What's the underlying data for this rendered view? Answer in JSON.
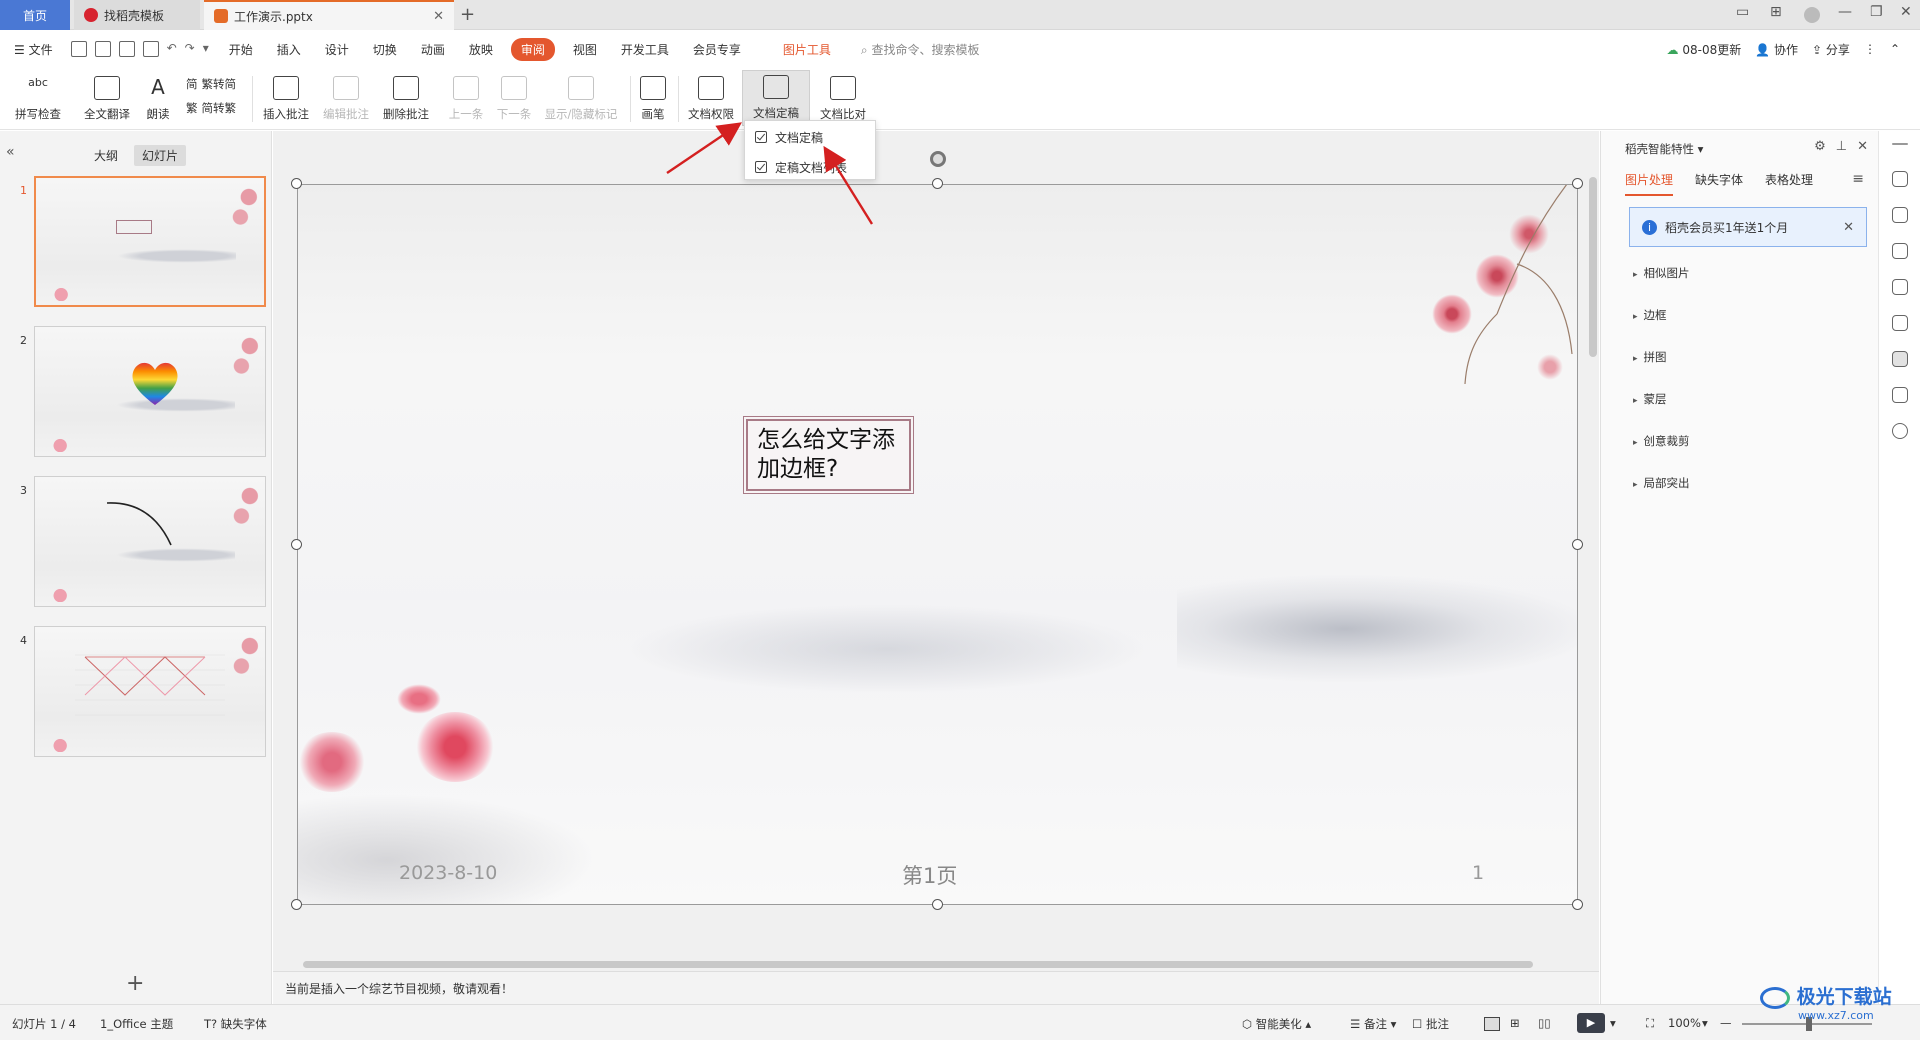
{
  "tabs": {
    "home": "首页",
    "template": "找稻壳模板",
    "doc": "工作演示.pptx"
  },
  "menu": {
    "file": "文件",
    "items": [
      "开始",
      "插入",
      "设计",
      "切换",
      "动画",
      "放映",
      "审阅",
      "视图",
      "开发工具",
      "会员专享"
    ],
    "active": "审阅",
    "picture_tool": "图片工具",
    "search_placeholder": "查找命令、搜索模板",
    "update": "08-08更新",
    "collab": "协作",
    "share": "分享"
  },
  "ribbon": {
    "spell_check": "拼写检查",
    "translate": "全文翻译",
    "read": "朗读",
    "trad_to_simp": "繁转简",
    "simp_to_trad": "简转繁",
    "insert_comment": "插入批注",
    "edit_comment": "编辑批注",
    "delete_comment": "删除批注",
    "prev": "上一条",
    "next": "下一条",
    "show_hide": "显示/隐藏标记",
    "pen": "画笔",
    "permission": "文档权限",
    "finalize": "文档定稿",
    "compare": "文档比对"
  },
  "dropdown": {
    "items": [
      "文档定稿",
      "定稿文档列表"
    ]
  },
  "leftpanel": {
    "tab_outline": "大纲",
    "tab_slides": "幻灯片",
    "slide_numbers": [
      "1",
      "2",
      "3",
      "4"
    ]
  },
  "slide": {
    "text": "怎么给文字添加边框?",
    "date": "2023-8-10",
    "page_label": "第1页",
    "number": "1"
  },
  "notes": "当前是插入一个综艺节目视频，敬请观看！",
  "rightpanel": {
    "title": "稻壳智能特性",
    "tabs": [
      "图片处理",
      "缺失字体",
      "表格处理"
    ],
    "banner": "稻壳会员买1年送1个月",
    "items": [
      "相似图片",
      "边框",
      "拼图",
      "蒙层",
      "创意裁剪",
      "局部突出"
    ]
  },
  "status": {
    "slide_count": "幻灯片 1 / 4",
    "theme": "1_Office 主题",
    "missing_font": "缺失字体",
    "beautify": "智能美化",
    "notes": "备注",
    "comments": "批注",
    "zoom": "100%"
  },
  "watermark": {
    "text": "极光下载站",
    "url": "www.xz7.com"
  },
  "colors": {
    "accent": "#e4572e",
    "home_tab": "#4a78d4",
    "arrow": "#d42020"
  }
}
